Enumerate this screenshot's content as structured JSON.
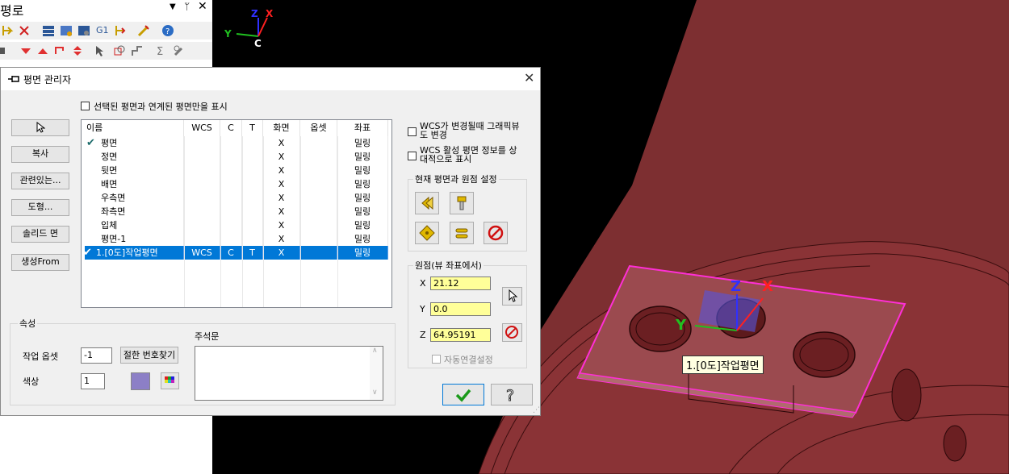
{
  "left_panel": {
    "title": "평로",
    "toolbar_text_g1": "G1"
  },
  "viewport": {
    "axis_top": {
      "z": "Z",
      "x": "X",
      "y": "Y",
      "c": "C"
    },
    "axis_part": {
      "z": "Z",
      "x": "X",
      "y": "Y"
    },
    "tooltip": "1.[0도]작업평면",
    "colors": {
      "part": "#7a2c2f",
      "plane_border": "#ff2fd6",
      "axis_x": "#ff2020",
      "axis_y": "#20c020",
      "axis_z": "#3030ff"
    }
  },
  "dialog": {
    "title": "평면 관리자",
    "filter_checkbox": "선택된 평면과 연계된 평면만을 표시",
    "left_buttons": [
      "복사",
      "관련있는...",
      "도형...",
      "솔리드 면",
      "생성From"
    ],
    "grid": {
      "columns": [
        "이름",
        "WCS",
        "C",
        "T",
        "화면",
        "옵셋",
        "좌표"
      ],
      "rows": [
        {
          "name": "평면",
          "wcs": "",
          "c": "",
          "t": "",
          "screen": "X",
          "offset": "",
          "coord": "밀링",
          "checked": true,
          "selected": false
        },
        {
          "name": "정면",
          "wcs": "",
          "c": "",
          "t": "",
          "screen": "X",
          "offset": "",
          "coord": "밀링",
          "checked": false,
          "selected": false
        },
        {
          "name": "뒷면",
          "wcs": "",
          "c": "",
          "t": "",
          "screen": "X",
          "offset": "",
          "coord": "밀링",
          "checked": false,
          "selected": false
        },
        {
          "name": "배면",
          "wcs": "",
          "c": "",
          "t": "",
          "screen": "X",
          "offset": "",
          "coord": "밀링",
          "checked": false,
          "selected": false
        },
        {
          "name": "우측면",
          "wcs": "",
          "c": "",
          "t": "",
          "screen": "X",
          "offset": "",
          "coord": "밀링",
          "checked": false,
          "selected": false
        },
        {
          "name": "좌측면",
          "wcs": "",
          "c": "",
          "t": "",
          "screen": "X",
          "offset": "",
          "coord": "밀링",
          "checked": false,
          "selected": false
        },
        {
          "name": "입체",
          "wcs": "",
          "c": "",
          "t": "",
          "screen": "X",
          "offset": "",
          "coord": "밀링",
          "checked": false,
          "selected": false
        },
        {
          "name": "평면-1",
          "wcs": "",
          "c": "",
          "t": "",
          "screen": "X",
          "offset": "",
          "coord": "밀링",
          "checked": false,
          "selected": false
        },
        {
          "name": "1.[0도]작업평면",
          "wcs": "WCS",
          "c": "C",
          "t": "T",
          "screen": "X",
          "offset": "",
          "coord": "밀링",
          "checked": true,
          "selected": true
        }
      ]
    },
    "right": {
      "chk_wcs_line1": "WCS가 변경될때 그래픽뷰",
      "chk_wcs_line2": "도 변경",
      "chk_rel_line1": "WCS 활성 평면 정보를 상",
      "chk_rel_line2": "대적으로 표시",
      "group_current": "현재 평면과 원점 설정",
      "group_origin": "원점(뷰 좌표에서)",
      "x_label": "X",
      "x_value": "21.12",
      "y_label": "Y",
      "y_value": "0.0",
      "z_label": "Z",
      "z_value": "64.95191",
      "auto_link": "자동연결설정"
    },
    "properties": {
      "group": "속성",
      "work_offset_label": "작업 옵셋",
      "work_offset_value": "-1",
      "find_number_button": "절한 번호찾기",
      "color_label": "색상",
      "color_value": "1",
      "color_swatch": "#8c7fc6",
      "notes_label": "주석문"
    }
  }
}
